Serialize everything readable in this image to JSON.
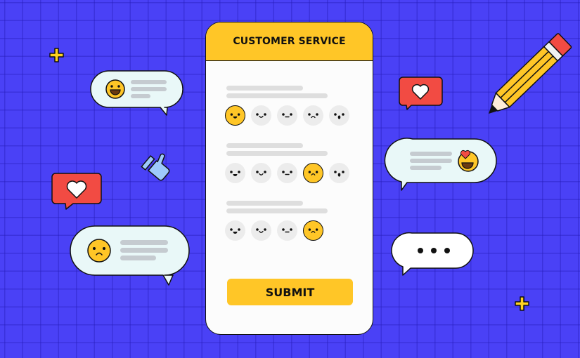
{
  "card": {
    "title": "CUSTOMER SERVICE",
    "submit_label": "SUBMIT",
    "questions": [
      {
        "faces": [
          "happy",
          "smile",
          "neutral",
          "sad",
          "surprised"
        ],
        "selected": 0
      },
      {
        "faces": [
          "happy",
          "smile",
          "neutral",
          "sad",
          "surprised"
        ],
        "selected": 3
      },
      {
        "faces": [
          "happy",
          "smile",
          "neutral",
          "sad"
        ],
        "selected": 3
      }
    ]
  },
  "colors": {
    "background": "#4a41f6",
    "accent_yellow": "#ffc627",
    "heart_red": "#f24b43",
    "bubble_fill": "#e9f8f8",
    "thumb_blue": "#9ec9fb"
  },
  "decorations": {
    "bubbles": [
      {
        "name": "laughing-emoji-bubble",
        "emoji": "laughing"
      },
      {
        "name": "sad-emoji-bubble",
        "emoji": "sad"
      },
      {
        "name": "heart-eyes-emoji-bubble",
        "emoji": "heart-eyes"
      },
      {
        "name": "typing-bubble",
        "emoji": "ellipsis"
      }
    ],
    "icons": [
      "plus-sparkle-icon",
      "heart-icon",
      "thumbs-up-icon",
      "pencil-icon"
    ]
  }
}
